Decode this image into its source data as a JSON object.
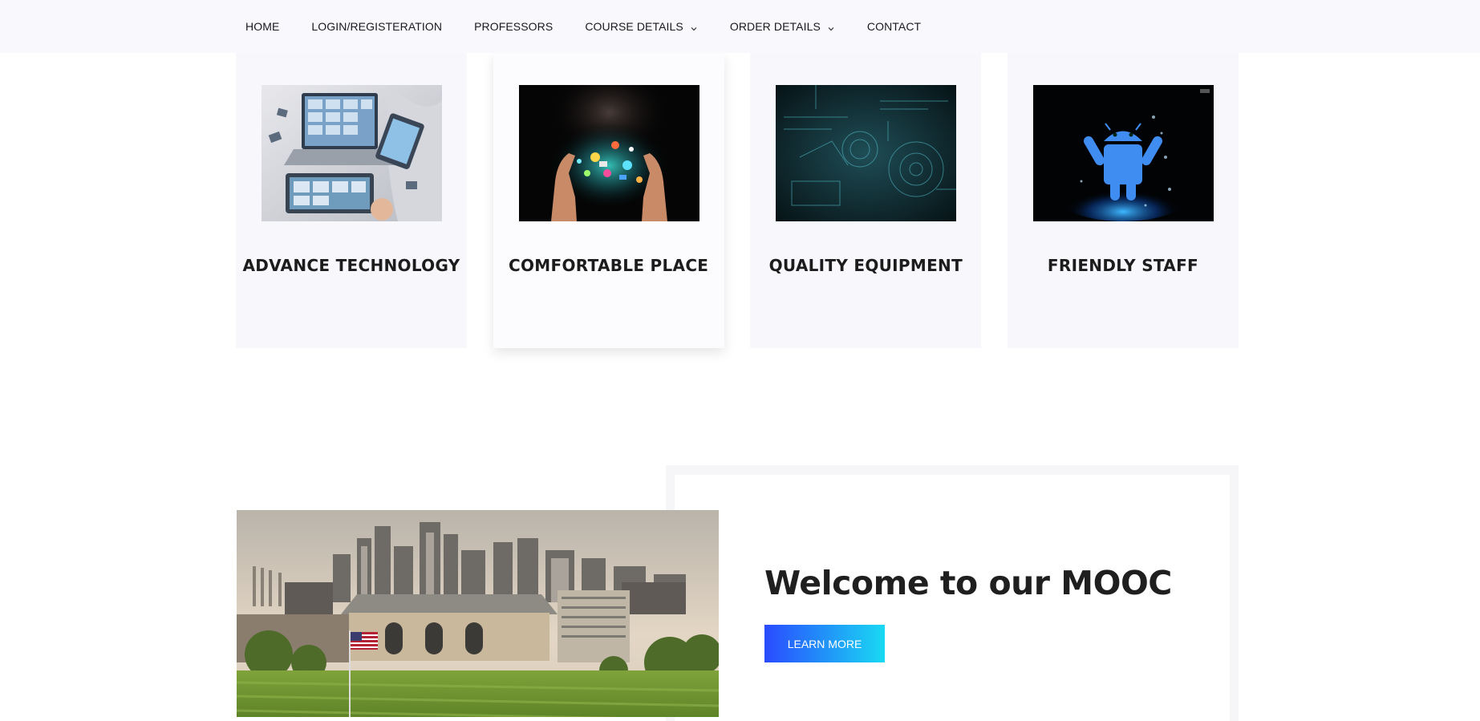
{
  "nav": {
    "items": [
      {
        "label": "HOME",
        "has_dropdown": false
      },
      {
        "label": "LOGIN/REGISTERATION",
        "has_dropdown": false
      },
      {
        "label": "PROFESSORS",
        "has_dropdown": false
      },
      {
        "label": "COURSE DETAILS",
        "has_dropdown": true
      },
      {
        "label": "ORDER DETAILS",
        "has_dropdown": true
      },
      {
        "label": "CONTACT",
        "has_dropdown": false
      }
    ]
  },
  "features": [
    {
      "title": "ADVANCE TECHNOLOGY",
      "image": "laptop-devices-image"
    },
    {
      "title": "COMFORTABLE PLACE",
      "image": "hands-tech-image",
      "active": true
    },
    {
      "title": "QUALITY EQUIPMENT",
      "image": "blueprint-image"
    },
    {
      "title": "FRIENDLY STAFF",
      "image": "android-splash-image"
    }
  ],
  "welcome": {
    "title": "Welcome to our MOOC",
    "button_label": "LEARN MORE",
    "image": "city-skyline-image"
  },
  "colors": {
    "nav_bg": "#f9f9fd",
    "card_bg": "#f7f7fc",
    "button_gradient_start": "#2a4bff",
    "button_gradient_end": "#19d9f2",
    "heading": "#1f1f1f"
  }
}
